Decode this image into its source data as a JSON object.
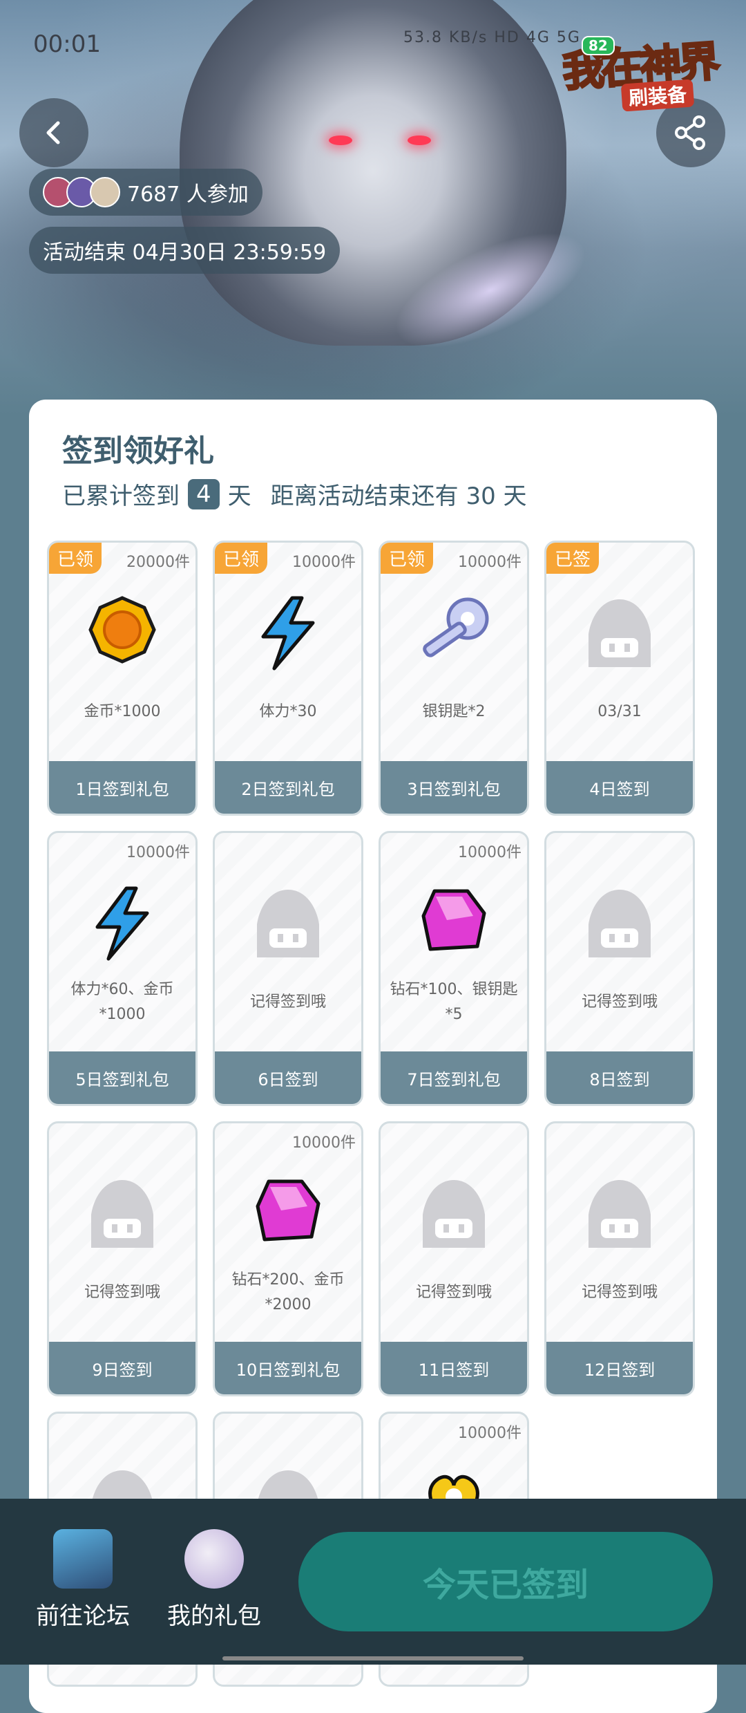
{
  "status_bar": {
    "time": "00:01",
    "icons_text": "53.8 KB/s  HD  4G  5G"
  },
  "header": {
    "participants_label": "7687 人参加",
    "activity_end": "活动结束 04月30日 23:59:59",
    "logo_text": "我在神界",
    "logo_sub": "刷装备",
    "logo_badge": "82"
  },
  "main": {
    "title": "签到领好礼",
    "sub_prefix": "已累计签到",
    "sub_days": "4",
    "sub_unit": "天",
    "sub_suffix": "距离活动结束还有 30 天"
  },
  "tiles": [
    {
      "tag": "已领",
      "stock": "20000件",
      "icon": "coin-icon",
      "desc": "金币*1000",
      "foot": "1日签到礼包"
    },
    {
      "tag": "已领",
      "stock": "10000件",
      "icon": "lightning-icon",
      "desc": "体力*30",
      "foot": "2日签到礼包"
    },
    {
      "tag": "已领",
      "stock": "10000件",
      "icon": "silver-key-icon",
      "desc": "银钥匙*2",
      "foot": "3日签到礼包"
    },
    {
      "tag": "已签",
      "stock": "",
      "icon": "placeholder-icon",
      "desc": "03/31",
      "foot": "4日签到"
    },
    {
      "tag": "",
      "stock": "10000件",
      "icon": "lightning-icon",
      "desc": "体力*60、金币*1000",
      "foot": "5日签到礼包"
    },
    {
      "tag": "",
      "stock": "",
      "icon": "placeholder-icon",
      "desc": "记得签到哦",
      "foot": "6日签到"
    },
    {
      "tag": "",
      "stock": "10000件",
      "icon": "gem-icon",
      "desc": "钻石*100、银钥匙*5",
      "foot": "7日签到礼包"
    },
    {
      "tag": "",
      "stock": "",
      "icon": "placeholder-icon",
      "desc": "记得签到哦",
      "foot": "8日签到"
    },
    {
      "tag": "",
      "stock": "",
      "icon": "placeholder-icon",
      "desc": "记得签到哦",
      "foot": "9日签到"
    },
    {
      "tag": "",
      "stock": "10000件",
      "icon": "gem-icon",
      "desc": "钻石*200、金币*2000",
      "foot": "10日签到礼包"
    },
    {
      "tag": "",
      "stock": "",
      "icon": "placeholder-icon",
      "desc": "记得签到哦",
      "foot": "11日签到"
    },
    {
      "tag": "",
      "stock": "",
      "icon": "placeholder-icon",
      "desc": "记得签到哦",
      "foot": "12日签到"
    },
    {
      "tag": "",
      "stock": "",
      "icon": "placeholder-icon",
      "desc": "",
      "foot": ""
    },
    {
      "tag": "",
      "stock": "",
      "icon": "placeholder-icon",
      "desc": "",
      "foot": ""
    },
    {
      "tag": "",
      "stock": "10000件",
      "icon": "heart-icon",
      "desc": "",
      "foot": ""
    }
  ],
  "bottom_bar": {
    "forum_label": "前往论坛",
    "gift_label": "我的礼包",
    "sign_button": "今天已签到"
  },
  "colors": {
    "accent": "#1a7d76",
    "tag": "#f7a536",
    "tile_footer": "#6c8a98"
  }
}
